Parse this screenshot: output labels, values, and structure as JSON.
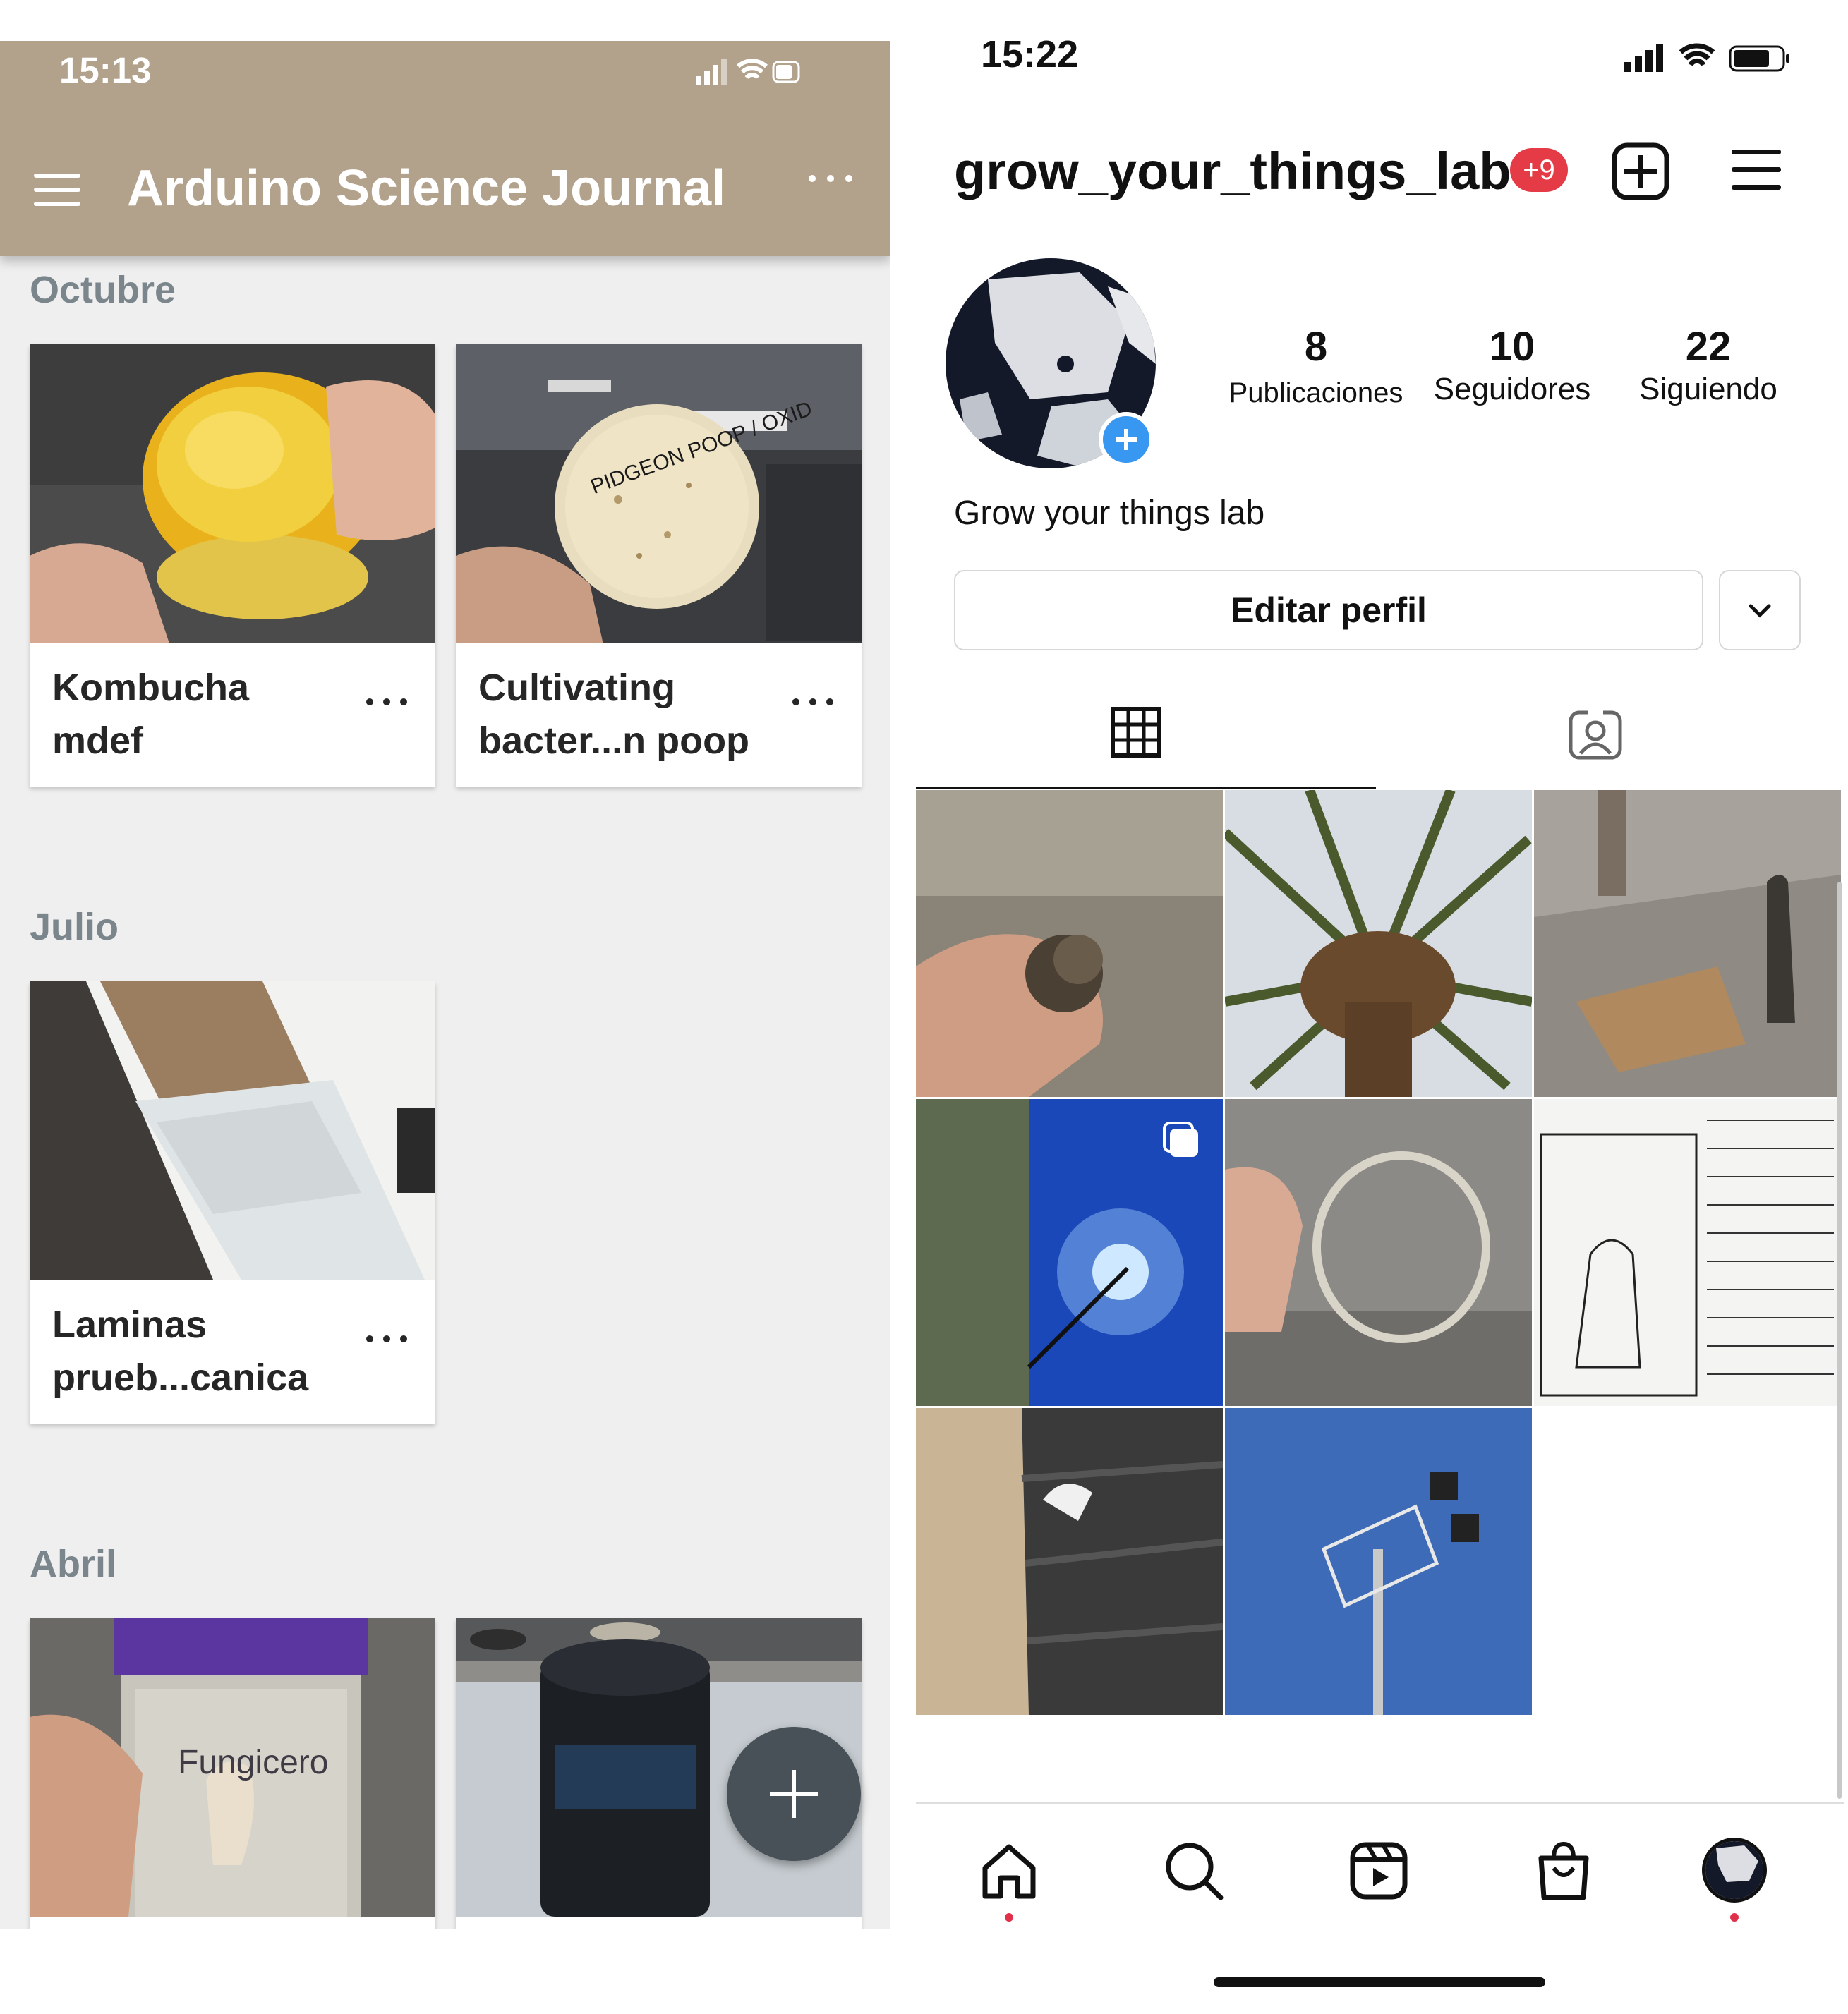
{
  "left_app": {
    "status": {
      "time": "15:13"
    },
    "app_bar": {
      "title": "Arduino Science Journal"
    },
    "sections": [
      {
        "heading": "Octubre",
        "cards": [
          {
            "title": "Kombucha mdef"
          },
          {
            "title": "Cultivating bacter...n poop"
          }
        ]
      },
      {
        "heading": "Julio",
        "cards": [
          {
            "title": "Laminas prueb...canica"
          }
        ]
      },
      {
        "heading": "Abril",
        "cards": [
          {
            "title": ""
          },
          {
            "title": ""
          }
        ]
      }
    ],
    "thumb_texts": {
      "petri_label": "PIDGEON POOP / OXID",
      "jar_label": "Fungicero"
    },
    "colors": {
      "app_bar": "#b2a18b",
      "background": "#efefef",
      "fab": "#475157"
    }
  },
  "right_app": {
    "status": {
      "time": "15:22"
    },
    "header": {
      "username": "grow_your_things_lab",
      "notification_badge": "+9"
    },
    "stats": [
      {
        "value": "8",
        "label": "Publicaciones"
      },
      {
        "value": "10",
        "label": "Seguidores"
      },
      {
        "value": "22",
        "label": "Siguiendo"
      }
    ],
    "profile_name": "Grow your things lab",
    "edit_button": "Editar perfil",
    "tabs": [
      {
        "icon": "grid-icon",
        "selected": true
      },
      {
        "icon": "tagged-person-icon",
        "selected": false
      }
    ],
    "nav": [
      "home-icon",
      "search-icon",
      "reels-icon",
      "shop-icon",
      "profile-avatar"
    ],
    "colors": {
      "badge": "#e53b46",
      "add_story": "#3897f0",
      "notification_dot": "#e0304a"
    }
  }
}
